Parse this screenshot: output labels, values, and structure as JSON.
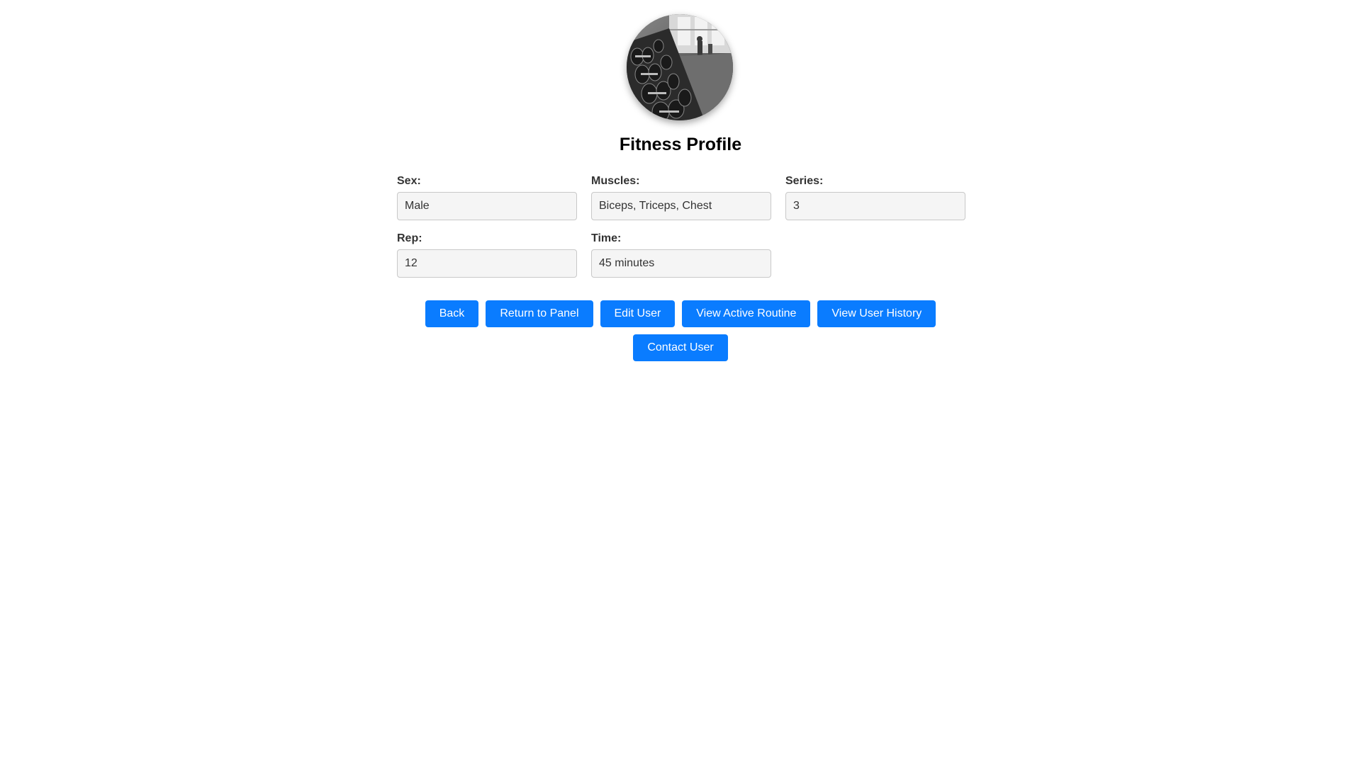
{
  "profile": {
    "title": "Fitness Profile"
  },
  "fields": [
    {
      "label": "Sex:",
      "value": "Male"
    },
    {
      "label": "Muscles:",
      "value": "Biceps, Triceps, Chest"
    },
    {
      "label": "Series:",
      "value": "3"
    },
    {
      "label": "Rep:",
      "value": "12"
    },
    {
      "label": "Time:",
      "value": "45 minutes"
    }
  ],
  "buttons": {
    "back": "Back",
    "return_to_panel": "Return to Panel",
    "edit_user": "Edit User",
    "view_active_routine": "View Active Routine",
    "view_user_history": "View User History",
    "contact_user": "Contact User"
  },
  "colors": {
    "button_bg": "#0a7cff",
    "input_bg": "#f5f5f5"
  },
  "icons": {
    "avatar": "gym-dumbbell-rack-photo"
  }
}
